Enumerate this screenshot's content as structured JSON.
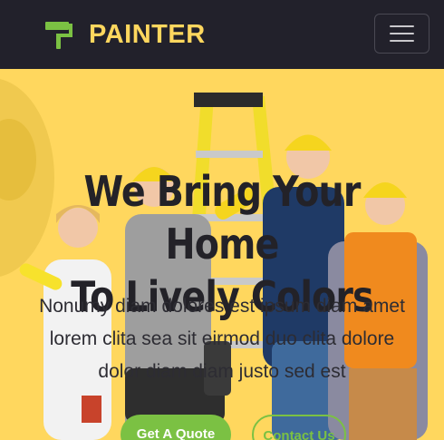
{
  "header": {
    "brand_name": "PAINTER",
    "logo_icon": "paint-roller-icon",
    "menu_icon": "hamburger-menu-icon"
  },
  "hero": {
    "title": "We Bring Your Home\nTo Lively Colors",
    "text": "Nonumy diam dolores est ipsum diam amet\nlorem clita sea sit eirmod duo clita dolore\ndolor diam diam justo sed est",
    "primary_button": "Get A Quote",
    "secondary_button": "Contact Us"
  },
  "colors": {
    "navbar_bg": "#22212b",
    "brand_yellow": "#ffd75e",
    "accent_green": "#7bc143",
    "hero_bg": "#ffd75e"
  }
}
